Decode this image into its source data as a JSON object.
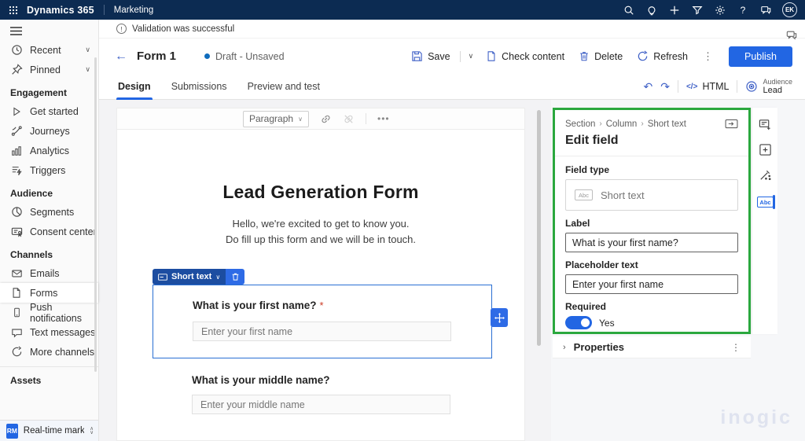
{
  "topbar": {
    "app_title": "Dynamics 365",
    "area": "Marketing",
    "avatar_initials": "EK"
  },
  "sidebar": {
    "recent": "Recent",
    "pinned": "Pinned",
    "engagement_header": "Engagement",
    "get_started": "Get started",
    "journeys": "Journeys",
    "analytics": "Analytics",
    "triggers": "Triggers",
    "audience_header": "Audience",
    "segments": "Segments",
    "consent_center": "Consent center",
    "channels_header": "Channels",
    "emails": "Emails",
    "forms": "Forms",
    "push_notifications": "Push notifications",
    "text_messages": "Text messages",
    "more_channels": "More channels",
    "assets_header": "Assets",
    "area_badge": "RM",
    "area_label": "Real-time marketi..."
  },
  "banner": {
    "message": "Validation was successful"
  },
  "command_bar": {
    "title": "Form 1",
    "status": "Draft - Unsaved",
    "save": "Save",
    "check_content": "Check content",
    "delete_label": "Delete",
    "refresh": "Refresh",
    "publish": "Publish"
  },
  "tabs": {
    "design": "Design",
    "submissions": "Submissions",
    "preview": "Preview and test"
  },
  "editor_tools": {
    "html": "HTML",
    "audience_label": "Audience",
    "audience_value": "Lead"
  },
  "canvas": {
    "block_type": "Paragraph",
    "title": "Lead Generation Form",
    "intro_line1": "Hello, we're excited to get to know you.",
    "intro_line2": "Do fill up this form and we will be in touch.",
    "chip_label": "Short text",
    "field1_label": "What is your first name?",
    "required_mark": "*",
    "field1_placeholder": "Enter your first name",
    "field2_label": "What is your middle name?",
    "field2_placeholder": "Enter your middle name"
  },
  "panel": {
    "breadcrumb_1": "Section",
    "breadcrumb_2": "Column",
    "breadcrumb_3": "Short text",
    "title": "Edit field",
    "field_type_label": "Field type",
    "field_type_value": "Short text",
    "field_type_icon_text": "Abc",
    "label_label": "Label",
    "label_value": "What is your first name?",
    "placeholder_label": "Placeholder text",
    "placeholder_value": "Enter your first name",
    "required_label": "Required",
    "required_value": "Yes",
    "properties_title": "Properties"
  },
  "watermark": "inogic",
  "colors": {
    "accent": "#2266E3",
    "topbar_bg": "#0C2B52",
    "annotation_green": "#2BA83E",
    "status_dot": "#0F6CBD"
  }
}
